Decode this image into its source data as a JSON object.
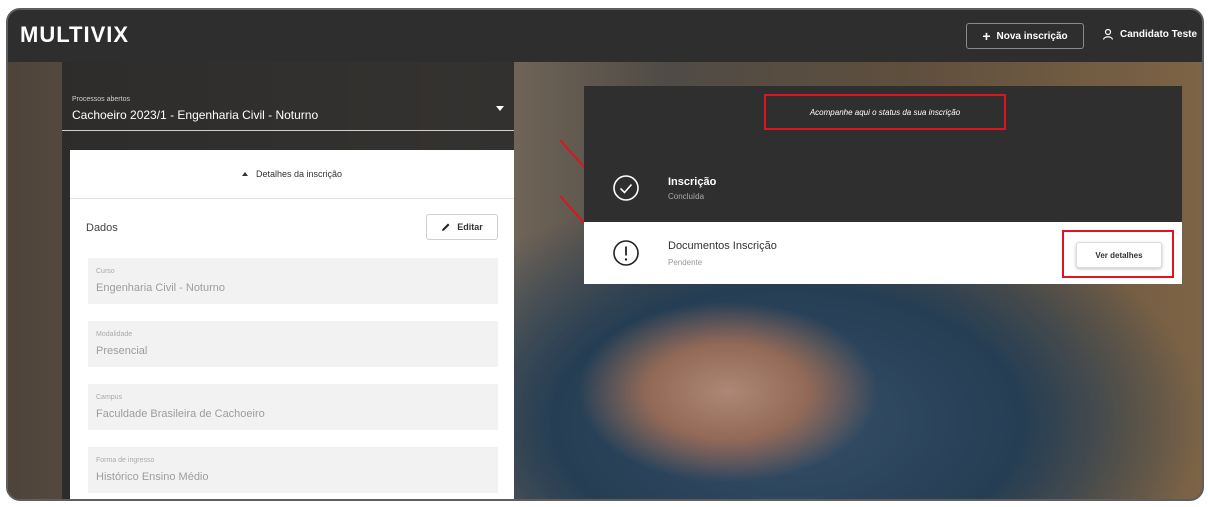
{
  "header": {
    "logo": "MULTIVIX",
    "new_button_label": "Nova inscrição",
    "user_name": "Candidato Teste"
  },
  "left_panel": {
    "process_label": "Processos abertos",
    "process_value": "Cachoeiro 2023/1 - Engenharia Civil - Noturno",
    "card_header": "Detalhes da inscrição",
    "section_title": "Dados",
    "edit_label": "Editar",
    "fields": [
      {
        "label": "Curso",
        "value": "Engenharia Civil - Noturno"
      },
      {
        "label": "Modalidade",
        "value": "Presencial"
      },
      {
        "label": "Campus",
        "value": "Faculdade Brasileira de Cachoeiro"
      },
      {
        "label": "Forma de ingresso",
        "value": "Histórico Ensino Médio"
      }
    ]
  },
  "status_panel": {
    "title": "Acompanhe aqui o status da sua inscrição",
    "steps": [
      {
        "title": "Inscrição",
        "status": "Concluída",
        "icon": "check-circle-icon"
      },
      {
        "title": "Documentos Inscrição",
        "status": "Pendente",
        "icon": "alert-circle-icon"
      }
    ],
    "details_button": "Ver detalhes"
  },
  "colors": {
    "highlight_red": "#e0141f",
    "dark_bar": "#2e2e2e"
  }
}
